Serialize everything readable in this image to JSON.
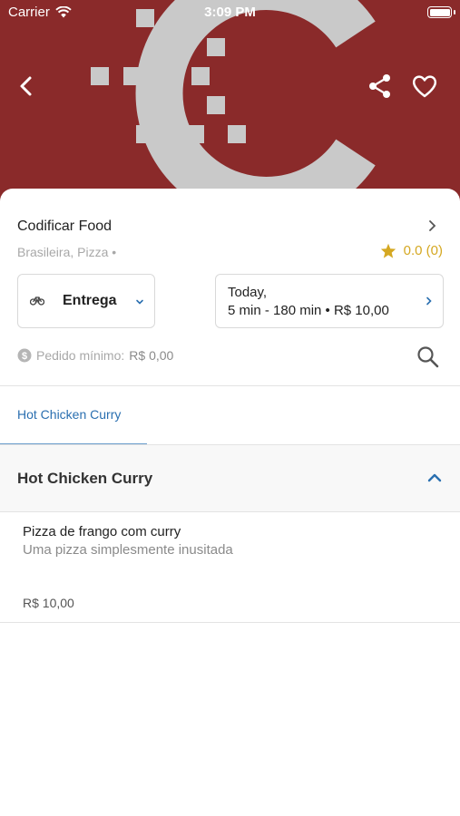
{
  "status_bar": {
    "carrier": "Carrier",
    "time": "3:09 PM"
  },
  "header": {
    "banner_color": "#8a2a2a",
    "icons": {
      "back": "chevron-left-icon",
      "share": "share-icon",
      "favorite": "heart-icon"
    }
  },
  "store": {
    "name": "Codificar Food",
    "tags": "Brasileira, Pizza •",
    "rating": "0.0 (0)"
  },
  "delivery": {
    "mode_label": "Entrega",
    "schedule_line1": "Today,",
    "schedule_line2": "5 min - 180 min • R$ 10,00"
  },
  "min_order": {
    "label": "Pedido mínimo:",
    "value": "R$ 0,00"
  },
  "tabs": [
    {
      "label": "Hot Chicken Curry",
      "active": true
    }
  ],
  "section": {
    "title": "Hot Chicken Curry"
  },
  "items": [
    {
      "name": "Pizza de frango com curry",
      "description": "Uma pizza simplesmente inusitada",
      "price": "R$ 10,00"
    }
  ],
  "colors": {
    "accent": "#2a6fb0",
    "rating": "#d5a822",
    "banner": "#8a2a2a"
  }
}
